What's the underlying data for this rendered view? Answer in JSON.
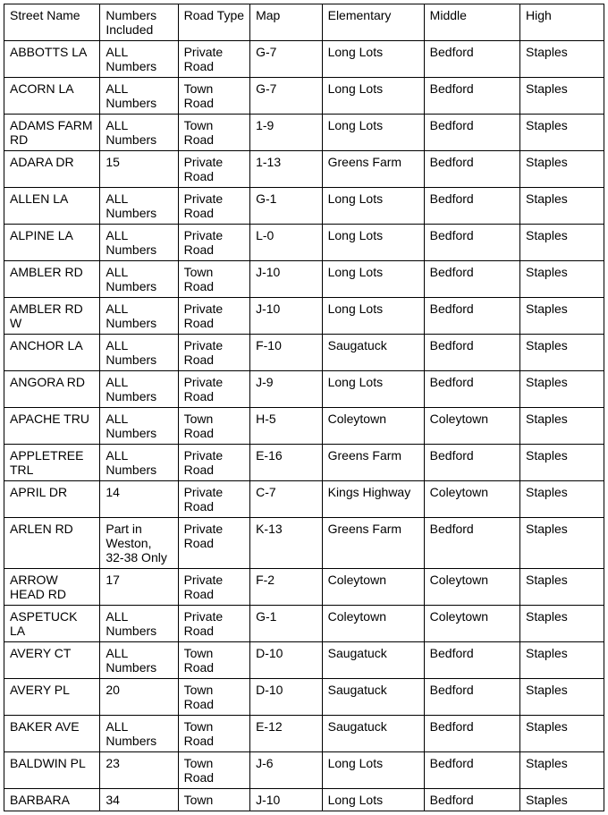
{
  "headers": [
    "Street Name",
    "Numbers Included",
    "Road Type",
    "Map",
    "Elementary",
    "Middle",
    "High"
  ],
  "rows": [
    [
      "ABBOTTS LA",
      "ALL Numbers",
      "Private Road",
      "G-7",
      "Long Lots",
      "Bedford",
      "Staples"
    ],
    [
      "ACORN LA",
      "ALL Numbers",
      "Town Road",
      "G-7",
      "Long Lots",
      "Bedford",
      "Staples"
    ],
    [
      "ADAMS FARM RD",
      "ALL Numbers",
      "Town Road",
      "1-9",
      "Long Lots",
      "Bedford",
      "Staples"
    ],
    [
      "ADARA DR",
      "15",
      "Private Road",
      "1-13",
      "Greens Farm",
      "Bedford",
      "Staples"
    ],
    [
      "ALLEN LA",
      "ALL Numbers",
      "Private Road",
      "G-1",
      "Long Lots",
      "Bedford",
      "Staples"
    ],
    [
      "ALPINE LA",
      "ALL Numbers",
      "Private Road",
      "L-0",
      "Long Lots",
      "Bedford",
      "Staples"
    ],
    [
      "AMBLER RD",
      "ALL Numbers",
      "Town Road",
      "J-10",
      "Long Lots",
      "Bedford",
      "Staples"
    ],
    [
      "AMBLER RD W",
      "ALL Numbers",
      "Private Road",
      "J-10",
      "Long Lots",
      "Bedford",
      "Staples"
    ],
    [
      "ANCHOR LA",
      "ALL Numbers",
      "Private Road",
      "F-10",
      "Saugatuck",
      "Bedford",
      "Staples"
    ],
    [
      "ANGORA RD",
      "ALL Numbers",
      "Private Road",
      "J-9",
      "Long Lots",
      "Bedford",
      "Staples"
    ],
    [
      "APACHE TRU",
      "ALL Numbers",
      "Town Road",
      "H-5",
      "Coleytown",
      "Coleytown",
      "Staples"
    ],
    [
      "APPLETREE TRL",
      "ALL Numbers",
      "Private Road",
      "E-16",
      "Greens Farm",
      "Bedford",
      "Staples"
    ],
    [
      "APRIL DR",
      "14",
      "Private Road",
      "C-7",
      "Kings Highway",
      "Coleytown",
      "Staples"
    ],
    [
      "ARLEN RD",
      "Part in Weston, 32-38 Only",
      "Private Road",
      "K-13",
      "Greens Farm",
      "Bedford",
      "Staples"
    ],
    [
      "ARROW HEAD RD",
      "17",
      "Private Road",
      "F-2",
      "Coleytown",
      "Coleytown",
      "Staples"
    ],
    [
      "ASPETUCK LA",
      "ALL Numbers",
      "Private Road",
      "G-1",
      "Coleytown",
      "Coleytown",
      "Staples"
    ],
    [
      "AVERY CT",
      "ALL Numbers",
      "Town Road",
      "D-10",
      "Saugatuck",
      "Bedford",
      "Staples"
    ],
    [
      "AVERY PL",
      "20",
      "Town Road",
      "D-10",
      "Saugatuck",
      "Bedford",
      "Staples"
    ],
    [
      "BAKER AVE",
      "ALL Numbers",
      "Town Road",
      "E-12",
      "Saugatuck",
      "Bedford",
      "Staples"
    ],
    [
      "BALDWIN PL",
      "23",
      "Town Road",
      "J-6",
      "Long Lots",
      "Bedford",
      "Staples"
    ],
    [
      "BARBARA",
      "34",
      "Town",
      "J-10",
      "Long Lots",
      "Bedford",
      "Staples"
    ]
  ]
}
